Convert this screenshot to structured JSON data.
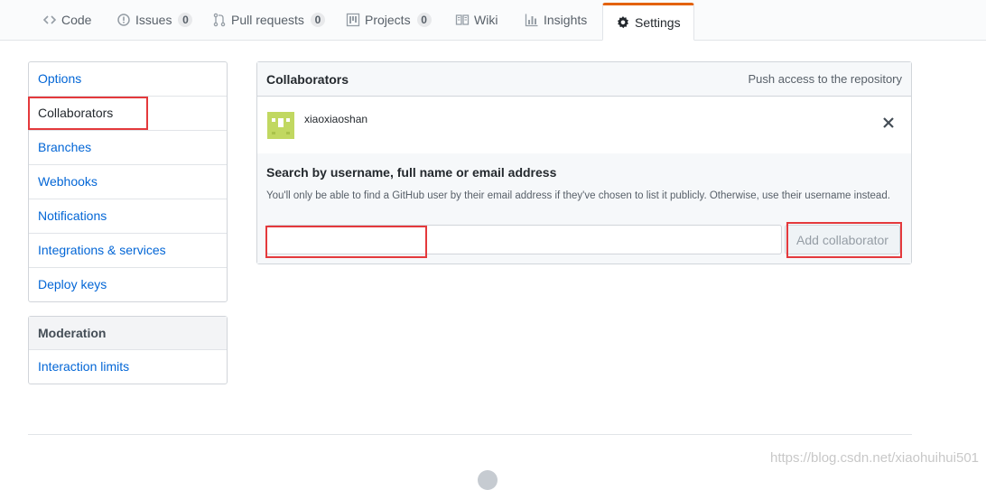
{
  "reponav": {
    "tabs": [
      {
        "label": "Code",
        "icon": "code-icon"
      },
      {
        "label": "Issues",
        "icon": "issue-icon",
        "count": "0"
      },
      {
        "label": "Pull requests",
        "icon": "pull-request-icon",
        "count": "0"
      },
      {
        "label": "Projects",
        "icon": "project-icon",
        "count": "0"
      },
      {
        "label": "Wiki",
        "icon": "book-icon"
      },
      {
        "label": "Insights",
        "icon": "graph-icon"
      },
      {
        "label": "Settings",
        "icon": "gear-icon",
        "selected": true
      }
    ]
  },
  "sidebar": {
    "items": [
      "Options",
      "Collaborators",
      "Branches",
      "Webhooks",
      "Notifications",
      "Integrations & services",
      "Deploy keys"
    ],
    "selected": "Collaborators",
    "moderation": {
      "heading": "Moderation",
      "items": [
        "Interaction limits"
      ]
    }
  },
  "collaborators": {
    "title": "Collaborators",
    "note": "Push access to the repository",
    "members": [
      {
        "username": "xiaoxiaoshan",
        "remove_icon": "close-icon"
      }
    ],
    "search": {
      "title": "Search by username, full name or email address",
      "help": "You'll only be able to find a GitHub user by their email address if they've chosen to list it publicly. Otherwise, use their username instead.",
      "input_value": "",
      "button_label": "Add collaborator"
    }
  },
  "colors": {
    "link": "#0366d6",
    "selected_tab_accent": "#e36209",
    "annotation_red": "#e4393c",
    "avatar": "#c1d861"
  },
  "watermark": "https://blog.csdn.net/xiaohuihui501"
}
